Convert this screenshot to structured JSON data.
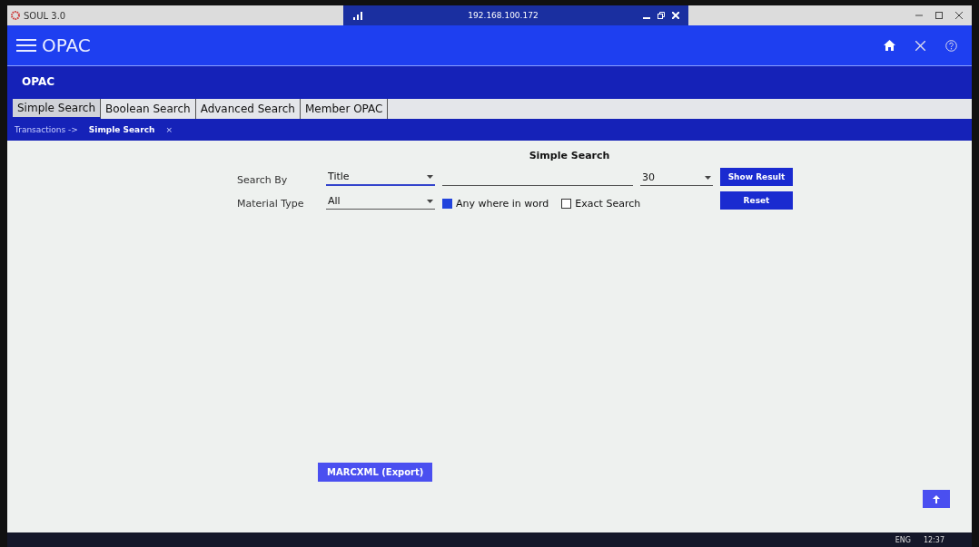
{
  "window": {
    "title": "SOUL 3.0"
  },
  "remote_bar": {
    "address": "192.168.100.172"
  },
  "header": {
    "app_name": "OPAC"
  },
  "section_title": "OPAC",
  "tabs": [
    {
      "label": "Simple Search",
      "selected": true
    },
    {
      "label": "Boolean Search",
      "selected": false
    },
    {
      "label": "Advanced Search",
      "selected": false
    },
    {
      "label": "Member OPAC",
      "selected": false
    }
  ],
  "breadcrumb": {
    "parent": "Transactions ->",
    "current": "Simple Search",
    "close": "×"
  },
  "form": {
    "title": "Simple Search",
    "search_by_label": "Search By",
    "search_by_value": "Title",
    "count_value": "30",
    "material_type_label": "Material Type",
    "material_type_value": "All",
    "options": [
      {
        "label": "Any where in word",
        "checked": true
      },
      {
        "label": "Exact Search",
        "checked": false
      }
    ],
    "buttons": [
      "Show Result",
      "Reset"
    ]
  },
  "export_button": "MARCXML (Export)",
  "taskbar": {
    "language": "ENG",
    "time": "12:37"
  }
}
